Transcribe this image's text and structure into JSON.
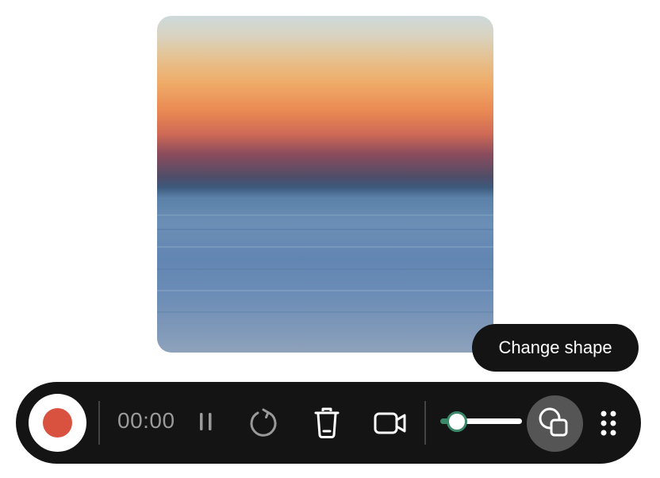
{
  "tooltip": {
    "text": "Change shape"
  },
  "toolbar": {
    "timer": "00:00",
    "volume_level": 0.2
  },
  "icons": {
    "record": "record-icon",
    "pause": "pause-icon",
    "restart": "restart-icon",
    "delete": "trash-icon",
    "camera": "video-camera-icon",
    "shape": "change-shape-icon",
    "drag": "drag-handle-icon"
  },
  "colors": {
    "toolbar_bg": "#141414",
    "record_red": "#d9513f",
    "slider_green": "#3a8a6a",
    "tooltip_bg": "#141414"
  }
}
